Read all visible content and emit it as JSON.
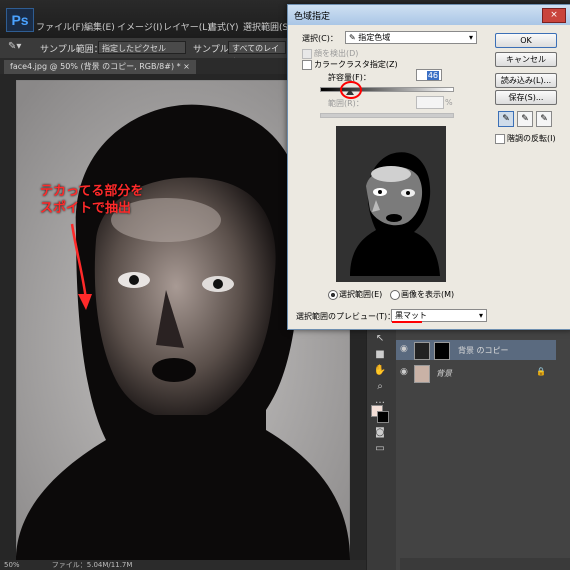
{
  "app": {
    "logo": "Ps"
  },
  "menu": [
    "ファイル(F)",
    "編集(E)",
    "イメージ(I)",
    "レイヤー(L)",
    "書式(Y)",
    "選択範囲(S)"
  ],
  "options_bar": {
    "sample_range_label": "サンプル範囲：",
    "sample_range_value": "指定したピクセル",
    "sample_label": "サンプル：",
    "sample_value": "すべてのレイヤー"
  },
  "document_tab": "face4.jpg @ 50% (背景 のコピー, RGB/8#) * ×",
  "annotation": {
    "line1": "テカってる部分を",
    "line2": "スポイトで抽出",
    "color": "#ff2a2a"
  },
  "status_bar": {
    "zoom": "50%",
    "info": "ファイル：5.04M/11.7M"
  },
  "dialog": {
    "title": "色域指定",
    "close": "×",
    "select_label": "選択(C)：",
    "select_value": "指定色域",
    "detect_faces": "顔を検出(D)",
    "localized_clusters": "カラークラスタ指定(Z)",
    "fuzziness_label": "許容量(F)：",
    "fuzziness_value": "46",
    "range_label": "範囲(R)：",
    "range_unit": "%",
    "ok": "OK",
    "cancel": "キャンセル",
    "load": "読み込み(L)...",
    "save": "保存(S)...",
    "invert": "階調の反転(I)",
    "radio_selection": "選択範囲(E)",
    "radio_image": "画像を表示(M)",
    "preview_label": "選択範囲のプレビュー(T)：",
    "preview_value": "黒マット",
    "slider_fraction": 0.23,
    "highlight_color": "#ff0000"
  },
  "layers": {
    "copy_name": "背景 のコピー",
    "bg_name": "背景",
    "selected_color": "#5a6a7f"
  }
}
